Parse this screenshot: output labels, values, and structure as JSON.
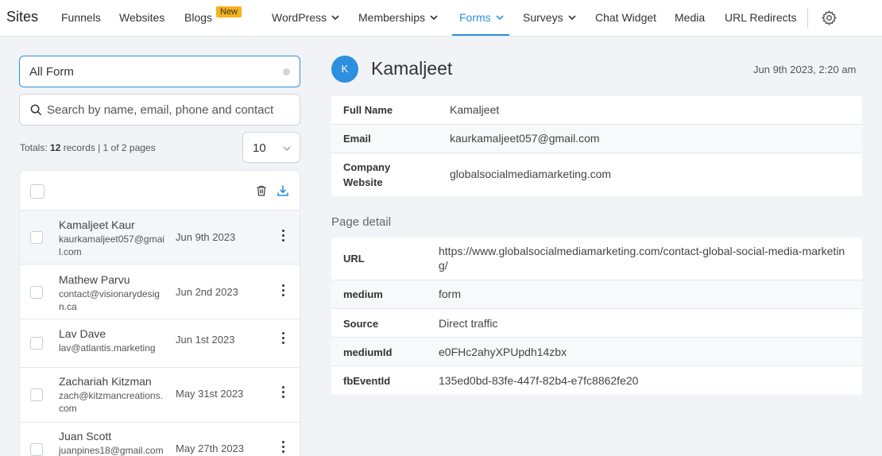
{
  "nav": {
    "brand": "Sites",
    "items": [
      {
        "label": "Funnels"
      },
      {
        "label": "Websites"
      },
      {
        "label": "Blogs"
      },
      {
        "label": "WordPress"
      },
      {
        "label": "Memberships"
      },
      {
        "label": "Forms"
      },
      {
        "label": "Surveys"
      },
      {
        "label": "Chat Widget"
      },
      {
        "label": "Media"
      },
      {
        "label": "URL Redirects"
      }
    ],
    "new_badge": "New",
    "active": "Forms"
  },
  "filter": {
    "form_select": "All Form",
    "search_placeholder": "Search by name, email, phone and contact"
  },
  "totals": {
    "prefix": "Totals:",
    "count": "12",
    "suffix": "records | 1 of 2 pages"
  },
  "page_size": "10",
  "submissions": [
    {
      "name": "Kamaljeet Kaur",
      "email": "kaurkamaljeet057@gmail.com",
      "date": "Jun 9th 2023"
    },
    {
      "name": "Mathew Parvu",
      "email": "contact@visionarydesign.ca",
      "date": "Jun 2nd 2023"
    },
    {
      "name": "Lav Dave",
      "email": "lav@atlantis.marketing",
      "date": "Jun 1st 2023"
    },
    {
      "name": "Zachariah Kitzman",
      "email": "zach@kitzmancreations.com",
      "date": "May 31st 2023"
    },
    {
      "name": "Juan Scott",
      "email": "juanpines18@gmail.com",
      "date": "May 27th 2023"
    }
  ],
  "contact": {
    "avatar_initial": "K",
    "name": "Kamaljeet",
    "submitted": "Jun 9th 2023, 2:20 am",
    "fields": [
      {
        "label": "Full Name",
        "value": "Kamaljeet"
      },
      {
        "label": "Email",
        "value": "kaurkamaljeet057@gmail.com"
      },
      {
        "label": "Company Website",
        "value": "globalsocialmediamarketing.com"
      }
    ]
  },
  "page_detail": {
    "title": "Page detail",
    "fields": [
      {
        "label": "URL",
        "value": "https://www.globalsocialmediamarketing.com/contact-global-social-media-marketing/"
      },
      {
        "label": "medium",
        "value": "form"
      },
      {
        "label": "Source",
        "value": "Direct traffic"
      },
      {
        "label": "mediumId",
        "value": "e0FHc2ahyXPUpdh14zbx"
      },
      {
        "label": "fbEventId",
        "value": "135ed0bd-83fe-447f-82b4-e7fc8862fe20"
      }
    ]
  },
  "colors": {
    "accent": "#2d8fe0",
    "badge": "#f5b31b"
  }
}
